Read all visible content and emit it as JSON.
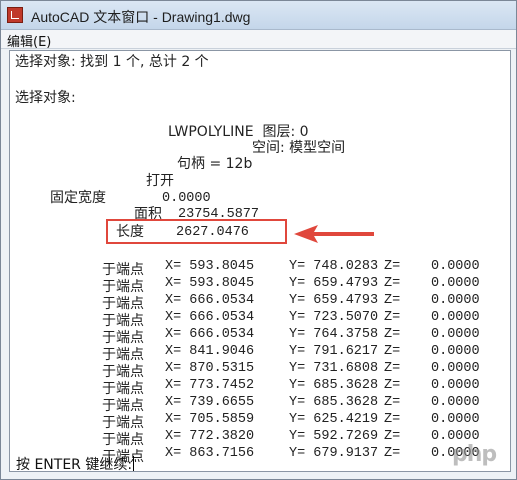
{
  "window": {
    "title": "AutoCAD 文本窗口 - Drawing1.dwg"
  },
  "menubar": {
    "edit": "编辑(E)"
  },
  "output": {
    "line1": "选择对象: 找到 1 个, 总计 2 个",
    "line2": "选择对象:",
    "entity": "LWPOLYLINE  图层: 0",
    "space": "空间: 模型空间",
    "handle": "句柄 = 12b",
    "open": "打开",
    "width_label": "固定宽度",
    "width_value": "0.0000",
    "area_label": "面积",
    "area_value": "23754.5877",
    "length_label": "长度",
    "length_value": "2627.0476"
  },
  "points_label": "于端点",
  "points": [
    {
      "x": "593.8045",
      "y": "748.0283",
      "z": "0.0000"
    },
    {
      "x": "593.8045",
      "y": "659.4793",
      "z": "0.0000"
    },
    {
      "x": "666.0534",
      "y": "659.4793",
      "z": "0.0000"
    },
    {
      "x": "666.0534",
      "y": "723.5070",
      "z": "0.0000"
    },
    {
      "x": "666.0534",
      "y": "764.3758",
      "z": "0.0000"
    },
    {
      "x": "841.9046",
      "y": "791.6217",
      "z": "0.0000"
    },
    {
      "x": "870.5315",
      "y": "731.6808",
      "z": "0.0000"
    },
    {
      "x": "773.7452",
      "y": "685.3628",
      "z": "0.0000"
    },
    {
      "x": "739.6655",
      "y": "685.3628",
      "z": "0.0000"
    },
    {
      "x": "705.5859",
      "y": "625.4219",
      "z": "0.0000"
    },
    {
      "x": "772.3820",
      "y": "592.7269",
      "z": "0.0000"
    },
    {
      "x": "863.7156",
      "y": "679.9137",
      "z": "0.0000"
    }
  ],
  "prompt": "按 ENTER 键继续:",
  "watermark": "php",
  "colors": {
    "highlight": "#e0473c"
  }
}
